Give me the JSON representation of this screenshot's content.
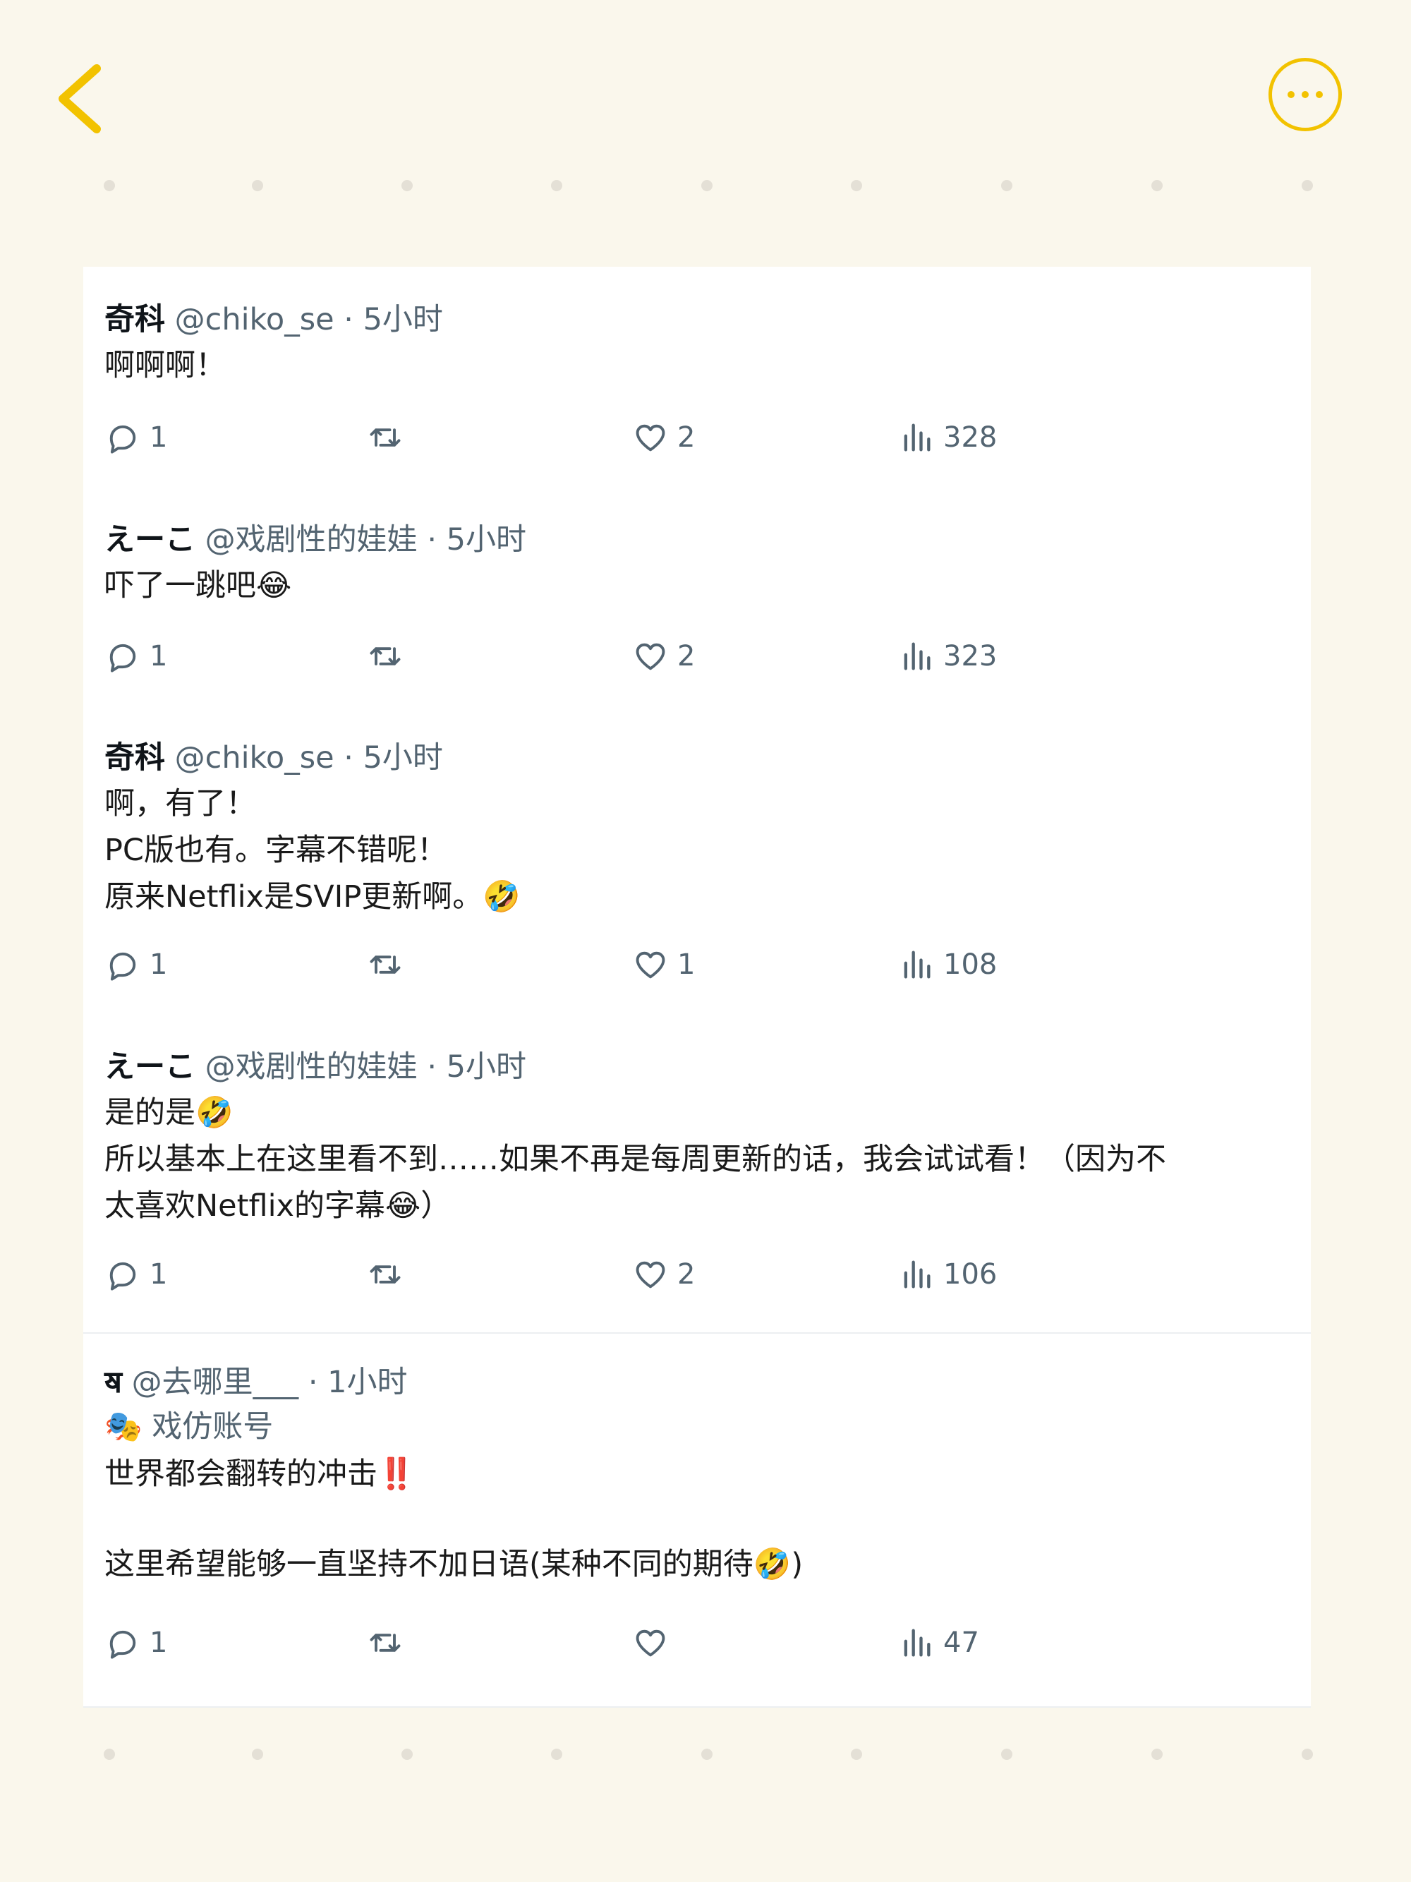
{
  "nav": {
    "back_icon": "chevron-left-icon",
    "more_icon": "ellipsis-circle-icon"
  },
  "colors": {
    "accent": "#f2c200",
    "background": "#faf7ec",
    "muted": "#536471"
  },
  "tweets": [
    {
      "name": "奇科",
      "handle": "@chiko_se",
      "time": " · 5小时",
      "lines": [
        "啊啊啊！"
      ],
      "reply": "1",
      "retweet": "",
      "like": "2",
      "views": "328"
    },
    {
      "name": "えーこ",
      "handle": "@戏剧性的娃娃",
      "time": " · 5小时",
      "lines": [
        "吓了一跳吧😂"
      ],
      "reply": "1",
      "retweet": "",
      "like": "2",
      "views": "323"
    },
    {
      "name": "奇科",
      "handle": "@chiko_se",
      "time": " · 5小时",
      "lines": [
        "啊，有了！",
        "PC版也有。字幕不错呢！",
        "原来Netflix是SVIP更新啊。🤣"
      ],
      "reply": "1",
      "retweet": "",
      "like": "1",
      "views": "108"
    },
    {
      "name": "えーこ",
      "handle": "@戏剧性的娃娃",
      "time": " · 5小时",
      "lines": [
        "是的是🤣",
        "所以基本上在这里看不到……如果不再是每周更新的话，我会试试看！（因为不",
        "太喜欢Netflix的字幕😂）"
      ],
      "reply": "1",
      "retweet": "",
      "like": "2",
      "views": "106"
    },
    {
      "name": "ॺ",
      "handle": " @去哪里___",
      "time": " · 1小时",
      "badge": "🎭 戏仿账号",
      "lines": [
        "世界都会翻转的冲击‼️",
        "",
        "这里希望能够一直坚持不加日语(某种不同的期待🤣)"
      ],
      "reply": "1",
      "retweet": "",
      "like": "",
      "views": "47"
    }
  ]
}
